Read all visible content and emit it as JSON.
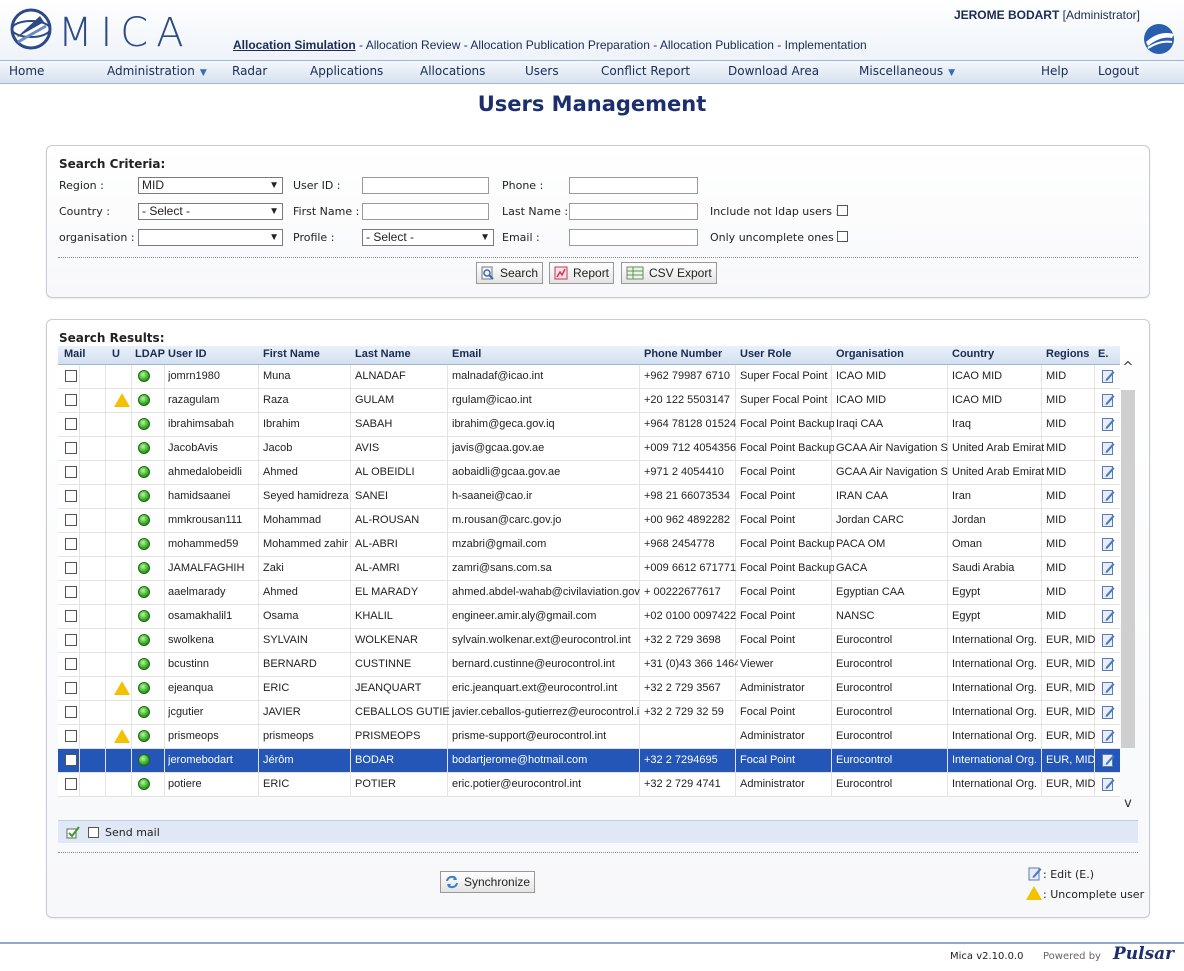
{
  "header": {
    "app_name": "MICA",
    "user_name": "JEROME BODART",
    "user_role": "[Administrator]",
    "steps": [
      {
        "label": "Allocation Simulation",
        "active": true
      },
      {
        "sep": " - "
      },
      {
        "label": "Allocation Review"
      },
      {
        "sep": " - "
      },
      {
        "label": "Allocation Publication Preparation"
      },
      {
        "sep": " - "
      },
      {
        "label": "Allocation Publication"
      },
      {
        "sep": " - "
      },
      {
        "label": "Implementation"
      }
    ]
  },
  "menu": {
    "home": "Home",
    "administration": "Administration",
    "radar": "Radar",
    "applications": "Applications",
    "allocations": "Allocations",
    "users": "Users",
    "conflict_report": "Conflict Report",
    "download_area": "Download Area",
    "miscellaneous": "Miscellaneous",
    "help": "Help",
    "logout": "Logout"
  },
  "page": {
    "title": "Users Management"
  },
  "search": {
    "title": "Search Criteria:",
    "region_label": "Region :",
    "region_value": "MID",
    "country_label": "Country :",
    "country_value": "- Select -",
    "organisation_label": "organisation :",
    "organisation_value": "",
    "userid_label": "User ID :",
    "firstname_label": "First Name :",
    "profile_label": "Profile :",
    "profile_value": "- Select -",
    "phone_label": "Phone :",
    "lastname_label": "Last Name :",
    "email_label": "Email :",
    "include_not_ldap_label": "Include not ldap users :",
    "only_uncomplete_label": "Only uncomplete ones :",
    "search_button": "Search",
    "report_button": "Report",
    "csv_button": "CSV Export"
  },
  "results": {
    "title": "Search Results:",
    "columns": [
      "Mail",
      "U",
      "LDAP",
      "User ID",
      "First Name",
      "Last Name",
      "Email",
      "Phone Number",
      "User Role",
      "Organisation",
      "Country",
      "Regions",
      "E."
    ],
    "rows": [
      {
        "uid": "jomrn1980",
        "first": "Muna",
        "last": "ALNADAF",
        "email": "malnadaf@icao.int",
        "phone": "+962 79987 6710",
        "role": "Super Focal Point",
        "org": "ICAO MID",
        "country": "ICAO MID",
        "regions": "MID",
        "warn": false
      },
      {
        "uid": "razagulam",
        "first": "Raza",
        "last": "GULAM",
        "email": "rgulam@icao.int",
        "phone": "+20 122 5503147",
        "role": "Super Focal Point",
        "org": "ICAO MID",
        "country": "ICAO MID",
        "regions": "MID",
        "warn": true
      },
      {
        "uid": "ibrahimsabah",
        "first": "Ibrahim",
        "last": "SABAH",
        "email": "ibrahim@geca.gov.iq",
        "phone": "+964 78128 01524",
        "role": "Focal Point Backup",
        "org": "Iraqi CAA",
        "country": "Iraq",
        "regions": "MID",
        "warn": false
      },
      {
        "uid": "JacobAvis",
        "first": "Jacob",
        "last": "AVIS",
        "email": "javis@gcaa.gov.ae",
        "phone": "+009 712 4054356",
        "role": "Focal Point Backup",
        "org": "GCAA Air Navigation S",
        "country": "United Arab Emirat",
        "regions": "MID",
        "warn": false
      },
      {
        "uid": "ahmedalobeidli",
        "first": "Ahmed",
        "last": "AL OBEIDLI",
        "email": "aobaidli@gcaa.gov.ae",
        "phone": "+971 2 4054410",
        "role": "Focal Point",
        "org": "GCAA Air Navigation S",
        "country": "United Arab Emirat",
        "regions": "MID",
        "warn": false
      },
      {
        "uid": "hamidsaanei",
        "first": "Seyed hamidreza",
        "last": "SANEI",
        "email": "h-saanei@cao.ir",
        "phone": "+98 21 66073534",
        "role": "Focal Point",
        "org": "IRAN CAA",
        "country": "Iran",
        "regions": "MID",
        "warn": false
      },
      {
        "uid": "mmkrousan111",
        "first": "Mohammad",
        "last": "AL-ROUSAN",
        "email": "m.rousan@carc.gov.jo",
        "phone": "+00 962 4892282",
        "role": "Focal Point",
        "org": "Jordan CARC",
        "country": "Jordan",
        "regions": "MID",
        "warn": false
      },
      {
        "uid": "mohammed59",
        "first": "Mohammed zahir",
        "last": "AL-ABRI",
        "email": "mzabri@gmail.com",
        "phone": "+968 2454778",
        "role": "Focal Point Backup",
        "org": "PACA OM",
        "country": "Oman",
        "regions": "MID",
        "warn": false
      },
      {
        "uid": "JAMALFAGHIH",
        "first": "Zaki",
        "last": "AL-AMRI",
        "email": "zamri@sans.com.sa",
        "phone": "+009 6612 671771",
        "role": "Focal Point Backup",
        "org": "GACA",
        "country": "Saudi Arabia",
        "regions": "MID",
        "warn": false
      },
      {
        "uid": "aaelmarady",
        "first": "Ahmed",
        "last": "EL MARADY",
        "email": "ahmed.abdel-wahab@civilaviation.gov.e",
        "phone": "+ 00222677617",
        "role": "Focal Point",
        "org": "Egyptian CAA",
        "country": "Egypt",
        "regions": "MID",
        "warn": false
      },
      {
        "uid": "osamakhalil1",
        "first": "Osama",
        "last": "KHALIL",
        "email": "engineer.amir.aly@gmail.com",
        "phone": "+02 0100 0097422",
        "role": "Focal Point",
        "org": "NANSC",
        "country": "Egypt",
        "regions": "MID",
        "warn": false
      },
      {
        "uid": "swolkena",
        "first": "SYLVAIN",
        "last": "WOLKENAR",
        "email": "sylvain.wolkenar.ext@eurocontrol.int",
        "phone": "+32 2 729 3698",
        "role": "Focal Point",
        "org": "Eurocontrol",
        "country": "International Org.",
        "regions": "EUR, MID",
        "warn": false
      },
      {
        "uid": "bcustinn",
        "first": "BERNARD",
        "last": "CUSTINNE",
        "email": "bernard.custinne@eurocontrol.int",
        "phone": "+31 (0)43 366 1464",
        "role": "Viewer",
        "org": "Eurocontrol",
        "country": "International Org.",
        "regions": "EUR, MID",
        "warn": false
      },
      {
        "uid": "ejeanqua",
        "first": "ERIC",
        "last": "JEANQUART",
        "email": "eric.jeanquart.ext@eurocontrol.int",
        "phone": "+32 2 729 3567",
        "role": "Administrator",
        "org": "Eurocontrol",
        "country": "International Org.",
        "regions": "EUR, MID",
        "warn": true
      },
      {
        "uid": "jcgutier",
        "first": "JAVIER",
        "last": "CEBALLOS GUTIE",
        "email": "javier.ceballos-gutierrez@eurocontrol.in",
        "phone": "+32 2 729 32 59",
        "role": "Focal Point",
        "org": "Eurocontrol",
        "country": "International Org.",
        "regions": "EUR, MID",
        "warn": false
      },
      {
        "uid": "prismeops",
        "first": "prismeops",
        "last": "PRISMEOPS",
        "email": "prisme-support@eurocontrol.int",
        "phone": "",
        "role": "Administrator",
        "org": "Eurocontrol",
        "country": "International Org.",
        "regions": "EUR, MID",
        "warn": true
      },
      {
        "uid": "jeromebodart",
        "first": "Jérôm",
        "last": "BODAR",
        "email": "bodartjerome@hotmail.com",
        "phone": "+32 2 7294695",
        "role": "Focal Point",
        "org": "Eurocontrol",
        "country": "International Org.",
        "regions": "EUR, MID",
        "warn": false,
        "selected": true
      },
      {
        "uid": "potiere",
        "first": "ERIC",
        "last": "POTIER",
        "email": "eric.potier@eurocontrol.int",
        "phone": "+32 2 729 4741",
        "role": "Administrator",
        "org": "Eurocontrol",
        "country": "International Org.",
        "regions": "EUR, MID",
        "warn": false
      }
    ],
    "send_mail_label": "Send mail",
    "synchronize_button": "Synchronize",
    "legend_edit": ": Edit (E.)",
    "legend_uncomplete": ": Uncomplete user"
  },
  "footer": {
    "version": "Mica v2.10.0.0",
    "powered_by": "Powered by",
    "vendor": "Pulsar"
  },
  "colors": {
    "brand_blue": "#1b2f6e",
    "selected_row": "#2456b8",
    "ldap_green": "#2faa1e",
    "warning_yellow": "#f2c200"
  },
  "icons": {
    "logo": "globe-icon",
    "brand": "swoosh-logo-icon",
    "search": "magnifier-icon",
    "report": "report-icon",
    "csv": "spreadsheet-icon",
    "edit": "pencil-edit-icon",
    "warning": "warning-triangle-icon",
    "ldap": "green-status-dot-icon",
    "sync": "sync-icon"
  }
}
